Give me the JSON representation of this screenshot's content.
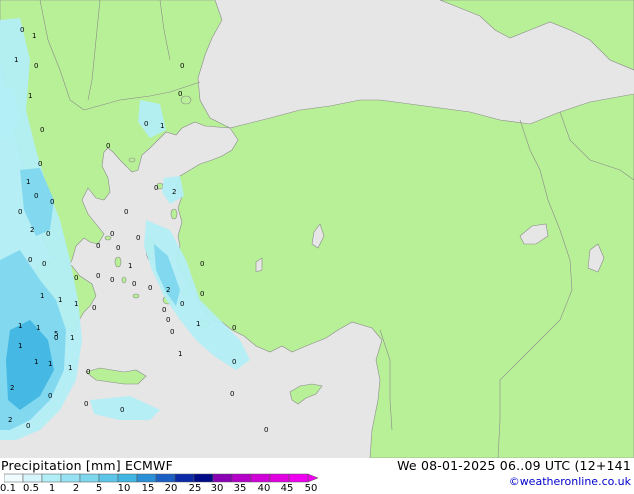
{
  "map": {
    "layers": {
      "sea_color": "#e6e6e6",
      "land_color": "#b8f097",
      "border_color": "#8a8a8a",
      "precip_light": "#b2eef6",
      "precip_mid": "#7fd7ee",
      "precip_heavy": "#41b6e2"
    },
    "labels": [
      "0",
      "1",
      "0",
      "1",
      "0",
      "0",
      "1",
      "0",
      "0",
      "0",
      "2",
      "0",
      "0",
      "0",
      "0",
      "1",
      "0",
      "0",
      "0",
      "0",
      "2",
      "0",
      "1",
      "0",
      "0",
      "0",
      "0",
      "1",
      "1",
      "1",
      "1",
      "0",
      "0",
      "0",
      "1",
      "1",
      "1",
      "5",
      "1",
      "2",
      "1",
      "1",
      "0",
      "0",
      "0",
      "0",
      "0",
      "2",
      "0",
      "0",
      "0",
      "0",
      "2",
      "0",
      "0",
      "1",
      "0",
      "1",
      "0",
      "1",
      "0",
      "0",
      "0",
      "0",
      "0",
      "0"
    ]
  },
  "legend": {
    "title": "Precipitation [mm]",
    "model": "ECMWF",
    "datetime": "We 08-01-2025 06..09 UTC (12+141",
    "credit": "©weatheronline.co.uk",
    "scale_labels": [
      "0.1",
      "0.5",
      "1",
      "2",
      "5",
      "10",
      "15",
      "20",
      "25",
      "30",
      "35",
      "40",
      "45",
      "50"
    ],
    "scale_colors": [
      "#f0fbfe",
      "#d5f4fb",
      "#b2eef6",
      "#96e2f4",
      "#7fd7ee",
      "#5cc5e8",
      "#41b6e2",
      "#2a8fd6",
      "#1c5fc4",
      "#0a2aa8",
      "#000b8a",
      "#8a00b4",
      "#b400c8",
      "#d000d8",
      "#e000e0",
      "#f000f0"
    ]
  }
}
